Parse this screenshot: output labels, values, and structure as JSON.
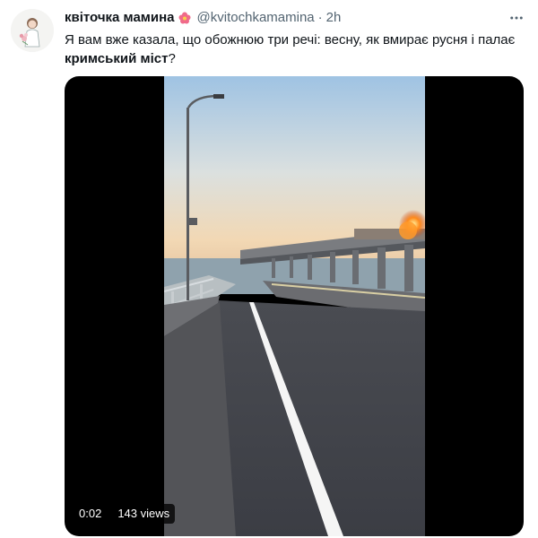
{
  "tweet": {
    "author": {
      "display_name": "квіточка мамина",
      "display_name_emoji": "flower-emoji",
      "handle": "@kvitochkamamina",
      "separator": "·",
      "time_ago": "2h"
    },
    "more_icon": "more-horizontal-icon",
    "text": {
      "part1": "Я вам вже казала, що обожнюю три речі: весну, як вмирає русня і палає ",
      "bold": "кримський міст",
      "part2": "?"
    },
    "media": {
      "type": "video",
      "duration": "0:02",
      "views": "143 views"
    }
  }
}
